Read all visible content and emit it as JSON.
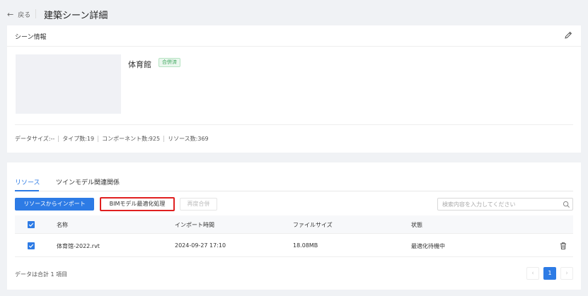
{
  "header": {
    "back_label": "戻る",
    "title": "建築シーン詳細"
  },
  "scene_info": {
    "section_title": "シーン情報",
    "name": "体育館",
    "status_badge": "合併済",
    "stats": {
      "data_size": "データサイズ:--",
      "type_count": "タイプ数:19",
      "component_count": "コンポーネント数:925",
      "resource_count": "リソース数:369"
    }
  },
  "tabs": [
    "リソース",
    "ツインモデル関連関係"
  ],
  "toolbar": {
    "import_label": "リソースからインポート",
    "bim_label": "BIMモデル最適化処理",
    "remerge_label": "再度合併"
  },
  "search": {
    "placeholder": "検索内容を入力してください",
    "value": ""
  },
  "table": {
    "columns": [
      "名称",
      "インポート時間",
      "ファイルサイズ",
      "状態"
    ],
    "rows": [
      {
        "name": "体育馆-2022.rvt",
        "import_time": "2024-09-27 17:10",
        "file_size": "18.08MB",
        "status": "最適化待機中",
        "checked": true
      }
    ]
  },
  "footer": {
    "total_label": "データは合計 1 項目"
  },
  "pagination": {
    "current": "1"
  },
  "colors": {
    "accent": "#2d7be5",
    "badge_green": "#3aa55a",
    "highlight": "#e02020"
  }
}
